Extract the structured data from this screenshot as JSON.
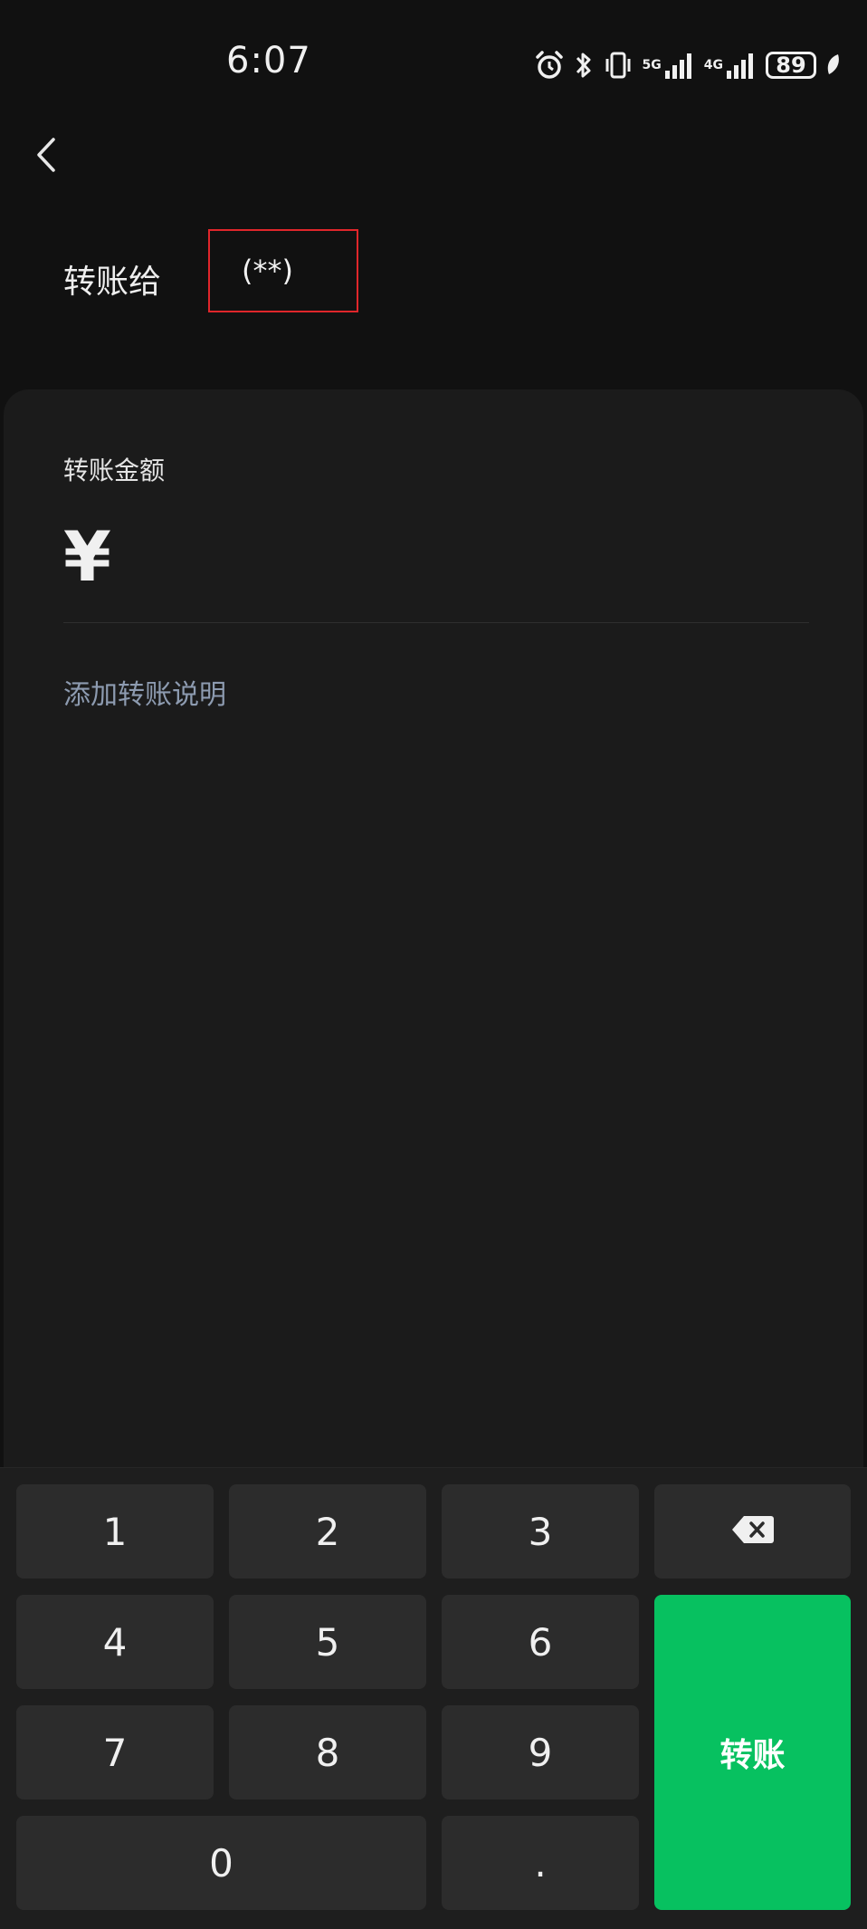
{
  "status_bar": {
    "time": "6:07",
    "network_1": "5G",
    "network_2": "4G",
    "battery": "89",
    "icons": [
      "alarm-icon",
      "bluetooth-icon",
      "vibrate-icon",
      "signal-icon",
      "signal-icon",
      "battery-icon",
      "leaf-icon"
    ]
  },
  "header": {
    "back_icon": "chevron-left-icon",
    "transfer_to_label": "转账给",
    "recipient_masked": "(**)"
  },
  "form": {
    "amount_label": "转账金额",
    "currency_symbol": "¥",
    "amount_value": "",
    "add_note_label": "添加转账说明"
  },
  "keypad": {
    "keys": [
      "1",
      "2",
      "3",
      "4",
      "5",
      "6",
      "7",
      "8",
      "9",
      "0",
      "."
    ],
    "delete_icon": "backspace-icon",
    "transfer_label": "转账",
    "transfer_color": "#07c160"
  }
}
